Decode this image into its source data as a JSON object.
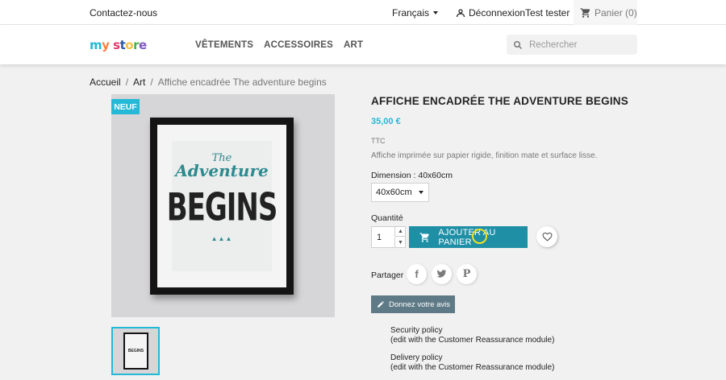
{
  "topbar": {
    "contact": "Contactez-nous",
    "language": "Français",
    "login": "Déconnexion",
    "user": "Test tester",
    "cart": "Panier (0)"
  },
  "header": {
    "logo": "my store",
    "nav": [
      "VÊTEMENTS",
      "ACCESSOIRES",
      "ART"
    ],
    "search_placeholder": "Rechercher"
  },
  "breadcrumb": [
    "Accueil",
    "Art",
    "Affiche encadrée The adventure begins"
  ],
  "product": {
    "badge": "NEUF",
    "title": "AFFICHE ENCADRÉE THE ADVENTURE BEGINS",
    "price": "35,00 €",
    "tax": "TTC",
    "description": "Affiche imprimée sur papier rigide, finition mate et surface lisse.",
    "dimension_label": "Dimension : 40x60cm",
    "dimension_value": "40x60cm",
    "quantity_label": "Quantité",
    "quantity_value": "1",
    "add_to_cart": "AJOUTER AU PANIER",
    "share_label": "Partager",
    "review_button": "Donnez votre avis",
    "poster": {
      "line1": "The",
      "line2": "Adventure",
      "line3": "BEGINS"
    }
  },
  "reassurance": [
    {
      "title": "Security policy",
      "sub": "(edit with the Customer Reassurance module)"
    },
    {
      "title": "Delivery policy",
      "sub": "(edit with the Customer Reassurance module)"
    }
  ],
  "colors": {
    "accent": "#24b9d7",
    "button": "#1f8fa6",
    "review": "#5e7a86"
  }
}
